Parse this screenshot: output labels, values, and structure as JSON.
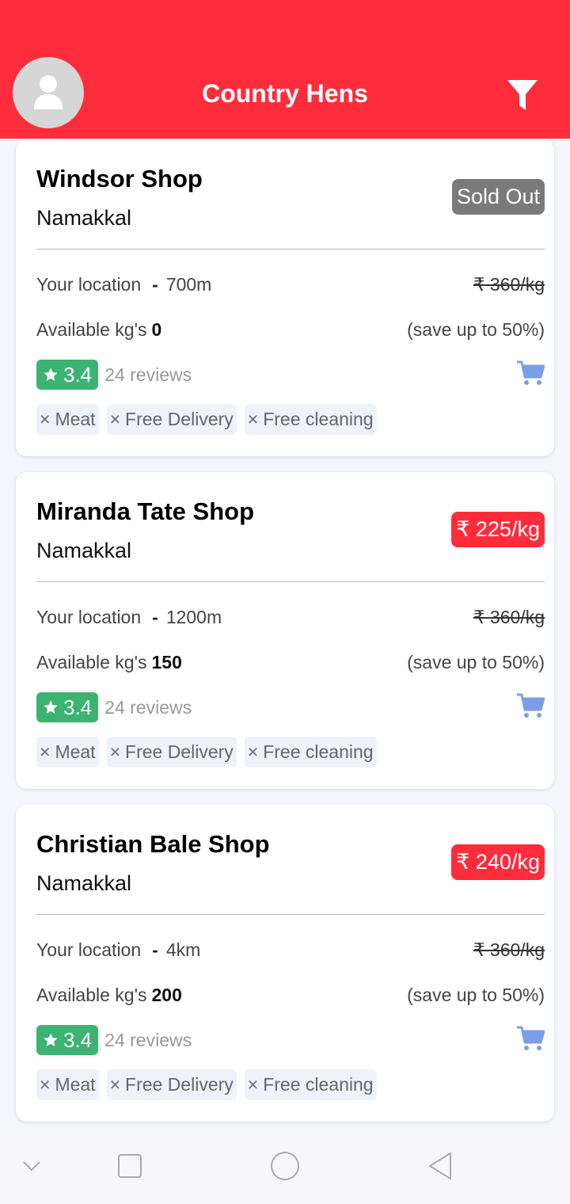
{
  "header": {
    "title": "Country Hens",
    "avatar_icon": "user-icon",
    "filter_icon": "filter-icon",
    "color": "#ff2d3b"
  },
  "shops": [
    {
      "name": "Windsor Shop",
      "city": "Namakkal",
      "badge": "Sold Out",
      "badge_type": "sold",
      "location_label": "Your location",
      "separator": "-",
      "distance": "700m",
      "original_price": "₹ 360/kg",
      "available_label": "Available kg's",
      "available": "0",
      "save_text": "(save up to 50%)",
      "rating": "3.4",
      "reviews": "24 reviews",
      "tags": [
        "Meat",
        "Free Delivery",
        "Free cleaning"
      ]
    },
    {
      "name": "Miranda Tate Shop",
      "city": "Namakkal",
      "badge": "₹ 225/kg",
      "badge_type": "price",
      "location_label": "Your location",
      "separator": "-",
      "distance": "1200m",
      "original_price": "₹ 360/kg",
      "available_label": "Available kg's",
      "available": "150",
      "save_text": "(save up to 50%)",
      "rating": "3.4",
      "reviews": "24 reviews",
      "tags": [
        "Meat",
        "Free Delivery",
        "Free cleaning"
      ]
    },
    {
      "name": "Christian Bale Shop",
      "city": "Namakkal",
      "badge": "₹ 240/kg",
      "badge_type": "price",
      "location_label": "Your location",
      "separator": "-",
      "distance": "4km",
      "original_price": "₹ 360/kg",
      "available_label": "Available kg's",
      "available": "200",
      "save_text": "(save up to 50%)",
      "rating": "3.4",
      "reviews": "24 reviews",
      "tags": [
        "Meat",
        "Free Delivery",
        "Free cleaning"
      ]
    }
  ],
  "tag_prefix": "×",
  "colors": {
    "rating": "#3cb371",
    "cart": "#7b9fe6",
    "sold_out": "#7a7a7a"
  }
}
